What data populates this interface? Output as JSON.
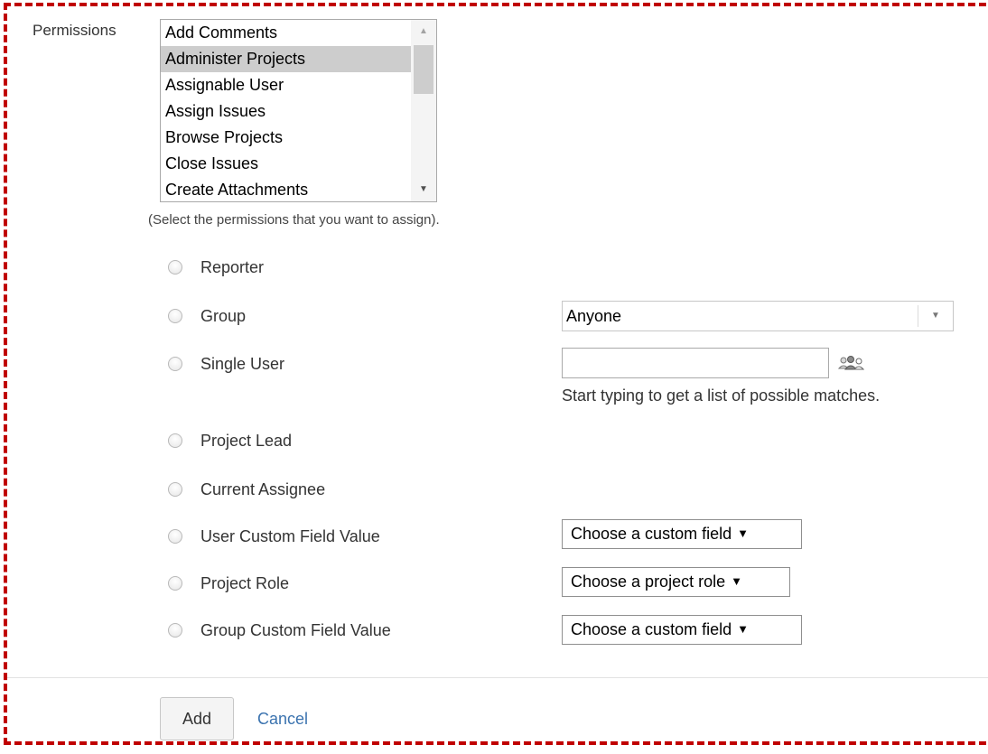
{
  "permissions": {
    "label": "Permissions",
    "options": [
      {
        "label": "Add Comments",
        "selected": false
      },
      {
        "label": "Administer Projects",
        "selected": true
      },
      {
        "label": "Assignable User",
        "selected": false
      },
      {
        "label": "Assign Issues",
        "selected": false
      },
      {
        "label": "Browse Projects",
        "selected": false
      },
      {
        "label": "Close Issues",
        "selected": false
      },
      {
        "label": "Create Attachments",
        "selected": false
      }
    ],
    "hint": "(Select the permissions that you want to assign)."
  },
  "grantees": {
    "reporter": {
      "label": "Reporter"
    },
    "group": {
      "label": "Group",
      "select_value": "Anyone"
    },
    "single_user": {
      "label": "Single User",
      "input_value": "",
      "help": "Start typing to get a list of possible matches.",
      "picker_icon": "users-icon"
    },
    "project_lead": {
      "label": "Project Lead"
    },
    "current_assignee": {
      "label": "Current Assignee"
    },
    "user_custom_field": {
      "label": "User Custom Field Value",
      "select_value": "Choose a custom field"
    },
    "project_role": {
      "label": "Project Role",
      "select_value": "Choose a project role"
    },
    "group_custom_field": {
      "label": "Group Custom Field Value",
      "select_value": "Choose a custom field"
    }
  },
  "footer": {
    "add_label": "Add",
    "cancel_label": "Cancel"
  },
  "colors": {
    "frame_border": "#c00000",
    "link": "#3b73af",
    "selected_option": "#cdcdcd"
  }
}
